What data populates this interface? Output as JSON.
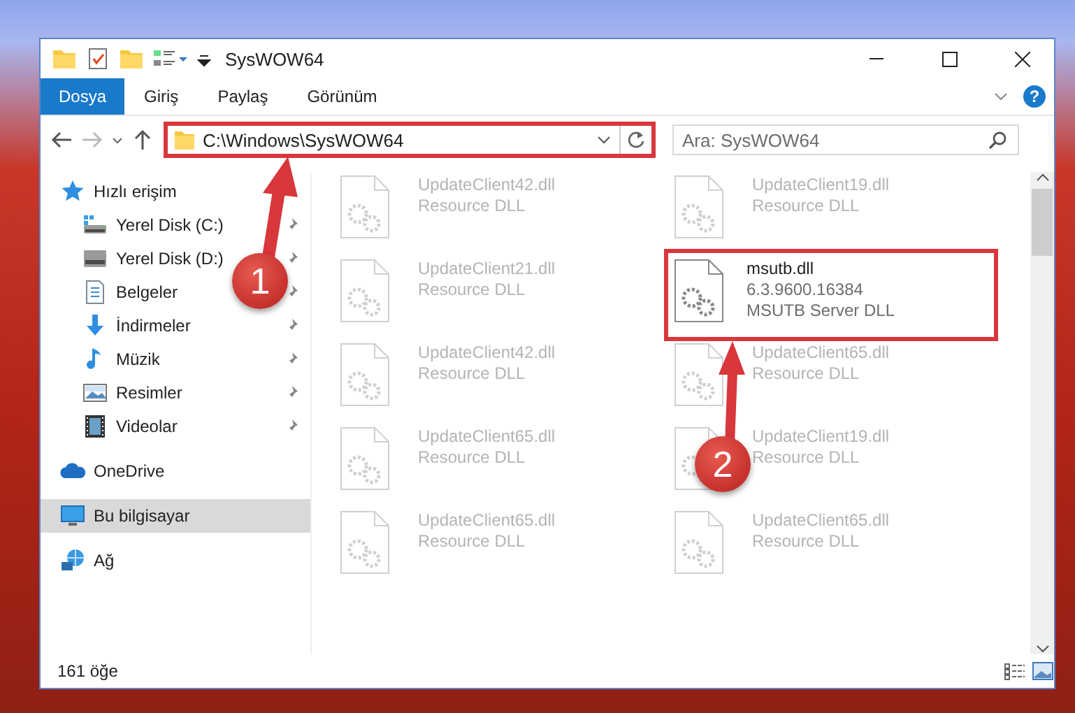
{
  "window": {
    "title": "SysWOW64"
  },
  "ribbon_tabs": [
    {
      "label": "Dosya",
      "selected": true
    },
    {
      "label": "Giriş",
      "selected": false
    },
    {
      "label": "Paylaş",
      "selected": false
    },
    {
      "label": "Görünüm",
      "selected": false
    }
  ],
  "help": {
    "label": "?"
  },
  "address": {
    "path": "C:\\Windows\\SysWOW64",
    "highlighted": true
  },
  "search": {
    "placeholder": "Ara: SysWOW64"
  },
  "sidebar": {
    "items": [
      {
        "label": "Hızlı erişim",
        "kind": "star",
        "selected": false,
        "children": [
          {
            "label": "Yerel Disk (C:)",
            "kind": "system-drive",
            "pinned": true
          },
          {
            "label": "Yerel Disk (D:)",
            "kind": "drive",
            "pinned": true
          },
          {
            "label": "Belgeler",
            "kind": "document",
            "pinned": true
          },
          {
            "label": "İndirmeler",
            "kind": "download",
            "pinned": true
          },
          {
            "label": "Müzik",
            "kind": "music",
            "pinned": true
          },
          {
            "label": "Resimler",
            "kind": "pictures",
            "pinned": true
          },
          {
            "label": "Videolar",
            "kind": "video",
            "pinned": true
          }
        ]
      },
      {
        "label": "OneDrive",
        "kind": "cloud",
        "selected": false
      },
      {
        "label": "Bu bilgisayar",
        "kind": "computer",
        "selected": true
      },
      {
        "label": "Ağ",
        "kind": "network",
        "selected": false
      }
    ]
  },
  "files": [
    {
      "name": "UpdateClient42.dll",
      "details": [
        "Resource DLL"
      ],
      "dimmed": true
    },
    {
      "name": "UpdateClient19.dll",
      "details": [
        "Resource DLL"
      ],
      "dimmed": true
    },
    {
      "name": "UpdateClient21.dll",
      "details": [
        "Resource DLL"
      ],
      "dimmed": true
    },
    {
      "name": "msutb.dll",
      "details": [
        "6.3.9600.16384",
        "MSUTB Server DLL"
      ],
      "dimmed": false,
      "highlighted": true
    },
    {
      "name": "UpdateClient42.dll",
      "details": [
        "Resource DLL"
      ],
      "dimmed": true
    },
    {
      "name": "UpdateClient65.dll",
      "details": [
        "Resource DLL"
      ],
      "dimmed": true
    },
    {
      "name": "UpdateClient65.dll",
      "details": [
        "Resource DLL"
      ],
      "dimmed": true
    },
    {
      "name": "UpdateClient19.dll",
      "details": [
        "Resource DLL"
      ],
      "dimmed": true
    },
    {
      "name": "UpdateClient65.dll",
      "details": [
        "Resource DLL"
      ],
      "dimmed": true
    },
    {
      "name": "UpdateClient65.dll",
      "details": [
        "Resource DLL"
      ],
      "dimmed": true
    }
  ],
  "status_bar": {
    "count": "161 öğe"
  },
  "annotations": [
    {
      "label": "1"
    },
    {
      "label": "2"
    }
  ]
}
